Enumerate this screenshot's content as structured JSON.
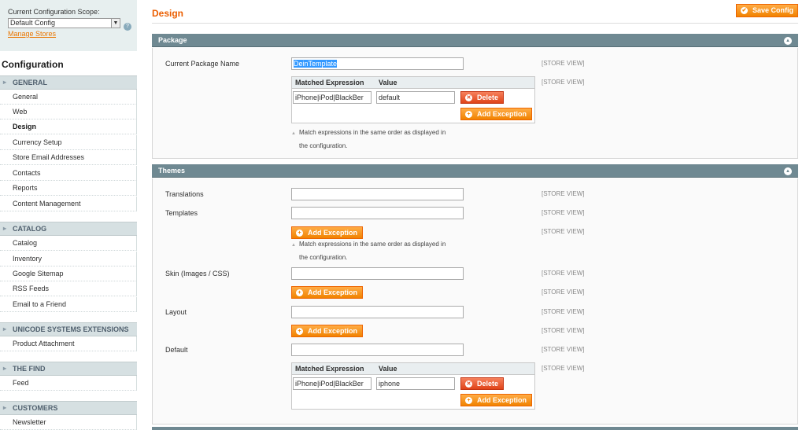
{
  "scope": {
    "label": "Current Configuration Scope:",
    "selected": "Default Config",
    "manage_stores": "Manage Stores"
  },
  "sidebar": {
    "title": "Configuration",
    "groups": [
      {
        "label": "GENERAL"
      },
      {
        "label": "CATALOG"
      },
      {
        "label": "UNICODE SYSTEMS EXTENSIONS"
      },
      {
        "label": "THE FIND"
      },
      {
        "label": "CUSTOMERS"
      }
    ],
    "items": {
      "general": "General",
      "web": "Web",
      "design": "Design",
      "currency": "Currency Setup",
      "store_email": "Store Email Addresses",
      "contacts": "Contacts",
      "reports": "Reports",
      "content": "Content Management",
      "catalog": "Catalog",
      "inventory": "Inventory",
      "sitemap": "Google Sitemap",
      "rss": "RSS Feeds",
      "email_friend": "Email to a Friend",
      "product_attachment": "Product Attachment",
      "feed": "Feed",
      "newsletter": "Newsletter"
    }
  },
  "page": {
    "title": "Design",
    "save_label": "Save Config"
  },
  "package": {
    "header": "Package",
    "current_label": "Current Package Name",
    "current_value": "DeinTemplate",
    "scope": "[STORE VIEW]",
    "grid_head": {
      "matched": "Matched Expression",
      "value": "Value"
    },
    "row": {
      "matched": "iPhone|iPod|BlackBer",
      "value": "default"
    },
    "delete": "Delete",
    "add_exception": "Add Exception",
    "note_line1": "Match expressions in the same order as displayed in",
    "note_line2": "the configuration."
  },
  "themes": {
    "header": "Themes",
    "translations": "Translations",
    "templates": "Templates",
    "skin": "Skin (Images / CSS)",
    "layout": "Layout",
    "default": "Default",
    "scope": "[STORE VIEW]",
    "add_exception": "Add Exception",
    "note_line1": "Match expressions in the same order as displayed in",
    "note_line2": "the configuration.",
    "grid_head": {
      "matched": "Matched Expression",
      "value": "Value"
    },
    "row": {
      "matched": "iPhone|iPod|BlackBer",
      "value": "iphone"
    },
    "delete": "Delete"
  },
  "colors": {
    "accent": "#eb5e00",
    "section_header": "#6f8992",
    "button": "#f18200"
  }
}
